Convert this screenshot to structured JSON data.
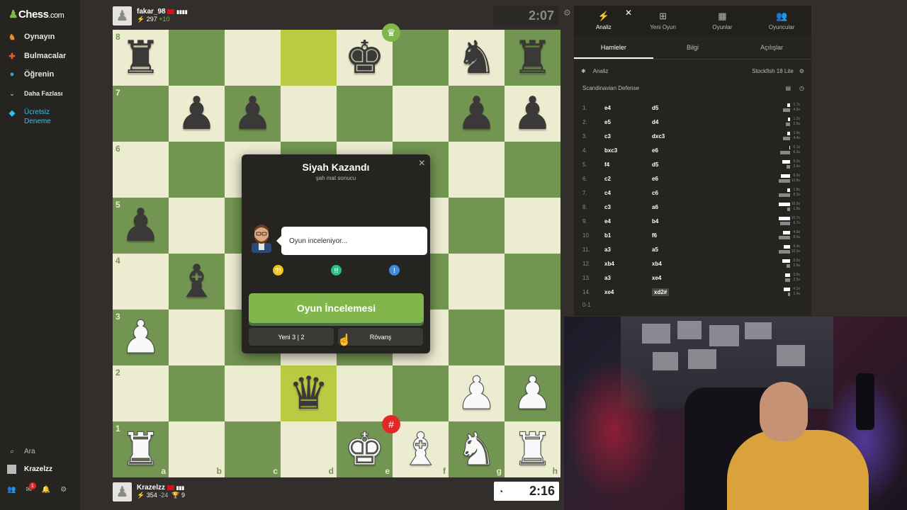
{
  "sidebar": {
    "logo_main": "Chess",
    "logo_com": ".com",
    "items": [
      {
        "label": "Oynayın",
        "icon": "play-icon",
        "color": "#e6912c"
      },
      {
        "label": "Bulmacalar",
        "icon": "puzzle-icon",
        "color": "#e85c2c"
      },
      {
        "label": "Öğrenin",
        "icon": "learn-icon",
        "color": "#3aa3dd"
      },
      {
        "label": "Daha Fazlası",
        "icon": "chevron-down-icon",
        "color": "#bababa"
      },
      {
        "label": "Ücretsiz Deneme",
        "icon": "diamond-icon",
        "color": "#2ec4ef"
      }
    ],
    "search_label": "Ara",
    "username": "Krazelzz",
    "notification_count": "1"
  },
  "top_player": {
    "name": "fakar_98",
    "flag_color": "#e30a17",
    "rating": "297",
    "rating_change": "+10",
    "clock": "2:07"
  },
  "bottom_player": {
    "name": "Krazelzz",
    "flag_color": "#e30a17",
    "rating": "354",
    "rating_change": "-24",
    "trophies": "9",
    "clock": "2:16"
  },
  "board": {
    "light_color": "#ebecd0",
    "dark_color": "#739552",
    "highlight_light": "#f5f682",
    "highlight_dark": "#b9ca43",
    "ranks": [
      "8",
      "7",
      "6",
      "5",
      "4",
      "3",
      "2",
      "1"
    ],
    "files": [
      "a",
      "b",
      "c",
      "d",
      "e",
      "f",
      "g",
      "h"
    ],
    "position": [
      [
        "br",
        "",
        "",
        "",
        "bk",
        "",
        "bn",
        "br"
      ],
      [
        "",
        "bp",
        "bp",
        "",
        "",
        "",
        "bp",
        "bp"
      ],
      [
        "",
        "",
        "",
        "",
        "",
        "",
        "",
        ""
      ],
      [
        "bp",
        "",
        "",
        "",
        "",
        "",
        "",
        ""
      ],
      [
        "",
        "bb",
        "",
        "",
        "",
        "",
        "",
        ""
      ],
      [
        "wp",
        "",
        "",
        "",
        "",
        "",
        "",
        ""
      ],
      [
        "",
        "",
        "",
        "bq",
        "",
        "",
        "wp",
        "wp"
      ],
      [
        "wr",
        "",
        "",
        "",
        "wk",
        "wb",
        "wn",
        "wr"
      ]
    ],
    "highlighted": [
      "d8",
      "d2"
    ],
    "winner_square": "e8",
    "mated_square": "e1"
  },
  "modal": {
    "title": "Siyah Kazandı",
    "subtitle": "şah mat sonucu",
    "coach_message": "Oyun inceleniyor...",
    "review_button": "Oyun İncelemesi",
    "new_game_button": "Yeni 3 | 2",
    "rematch_button": "Rövanş",
    "dot_colors": [
      "#f0c419",
      "#26c281",
      "#3a8de0"
    ],
    "dot_symbols": [
      "?!",
      "!!",
      "!"
    ]
  },
  "panel": {
    "top_tabs": [
      {
        "label": "Analiz",
        "icon": "bolt-icon"
      },
      {
        "label": "Yeni Oyun",
        "icon": "plus-icon"
      },
      {
        "label": "Oyunlar",
        "icon": "board-icon"
      },
      {
        "label": "Oyuncular",
        "icon": "players-icon"
      }
    ],
    "sub_tabs": [
      "Hamleler",
      "Bilgi",
      "Açılışlar"
    ],
    "analysis_label": "Analiz",
    "engine_label": "Stockfish 18 Lite",
    "opening": "Scandinavian Defense",
    "moves": [
      {
        "num": "1.",
        "white": "e4",
        "black": "d5",
        "wt": "1.7s",
        "bt": "4.6s",
        "wbar": 4,
        "bbar": 10
      },
      {
        "num": "2.",
        "white": "e5",
        "black": "d4",
        "wt": "1.2s",
        "bt": "2.5s",
        "wbar": 3,
        "bbar": 6
      },
      {
        "num": "3.",
        "white": "c3",
        "black": "dxc3",
        "wt": "1.9s",
        "bt": "4.4s",
        "wbar": 4,
        "bbar": 10
      },
      {
        "num": "4.",
        "white": "bxc3",
        "black": "e6",
        "wt": "0.1s",
        "bt": "6.3s",
        "wbar": 1,
        "bbar": 14
      },
      {
        "num": "5.",
        "white": "f4",
        "black": "d5",
        "wt": "5.0s",
        "bt": "2.4s",
        "wbar": 11,
        "bbar": 5
      },
      {
        "num": "6.",
        "white": "c2",
        "black": "e6",
        "wt": "6.9s",
        "bt": "13.8s",
        "wbar": 13,
        "bbar": 16
      },
      {
        "num": "7.",
        "white": "c4",
        "black": "c6",
        "wt": "1.8s",
        "bt": "8.3s",
        "wbar": 4,
        "bbar": 16
      },
      {
        "num": "8.",
        "white": "c3",
        "black": "a6",
        "wt": "16.9s",
        "bt": "1.9s",
        "wbar": 16,
        "bbar": 4
      },
      {
        "num": "9.",
        "white": "e4",
        "black": "b4",
        "wt": "10.7s",
        "bt": "6.7s",
        "wbar": 16,
        "bbar": 14
      },
      {
        "num": "10.",
        "white": "b1",
        "black": "f6",
        "wt": "4.9s",
        "bt": "8.5s",
        "wbar": 10,
        "bbar": 16
      },
      {
        "num": "11.",
        "white": "a3",
        "black": "a5",
        "wt": "4.4s",
        "bt": "10.0s",
        "wbar": 9,
        "bbar": 16
      },
      {
        "num": "12.",
        "white": "xb4",
        "black": "xb4",
        "wt": "5.5s",
        "bt": "2.6s",
        "wbar": 11,
        "bbar": 5
      },
      {
        "num": "13.",
        "white": "a3",
        "black": "xe4",
        "wt": "3.5s",
        "bt": "3.5s",
        "wbar": 7,
        "bbar": 7
      },
      {
        "num": "14.",
        "white": "xe4",
        "black": "xd2#",
        "wt": "4.3s",
        "bt": "1.4s",
        "wbar": 9,
        "bbar": 3
      }
    ],
    "result": "0-1"
  }
}
